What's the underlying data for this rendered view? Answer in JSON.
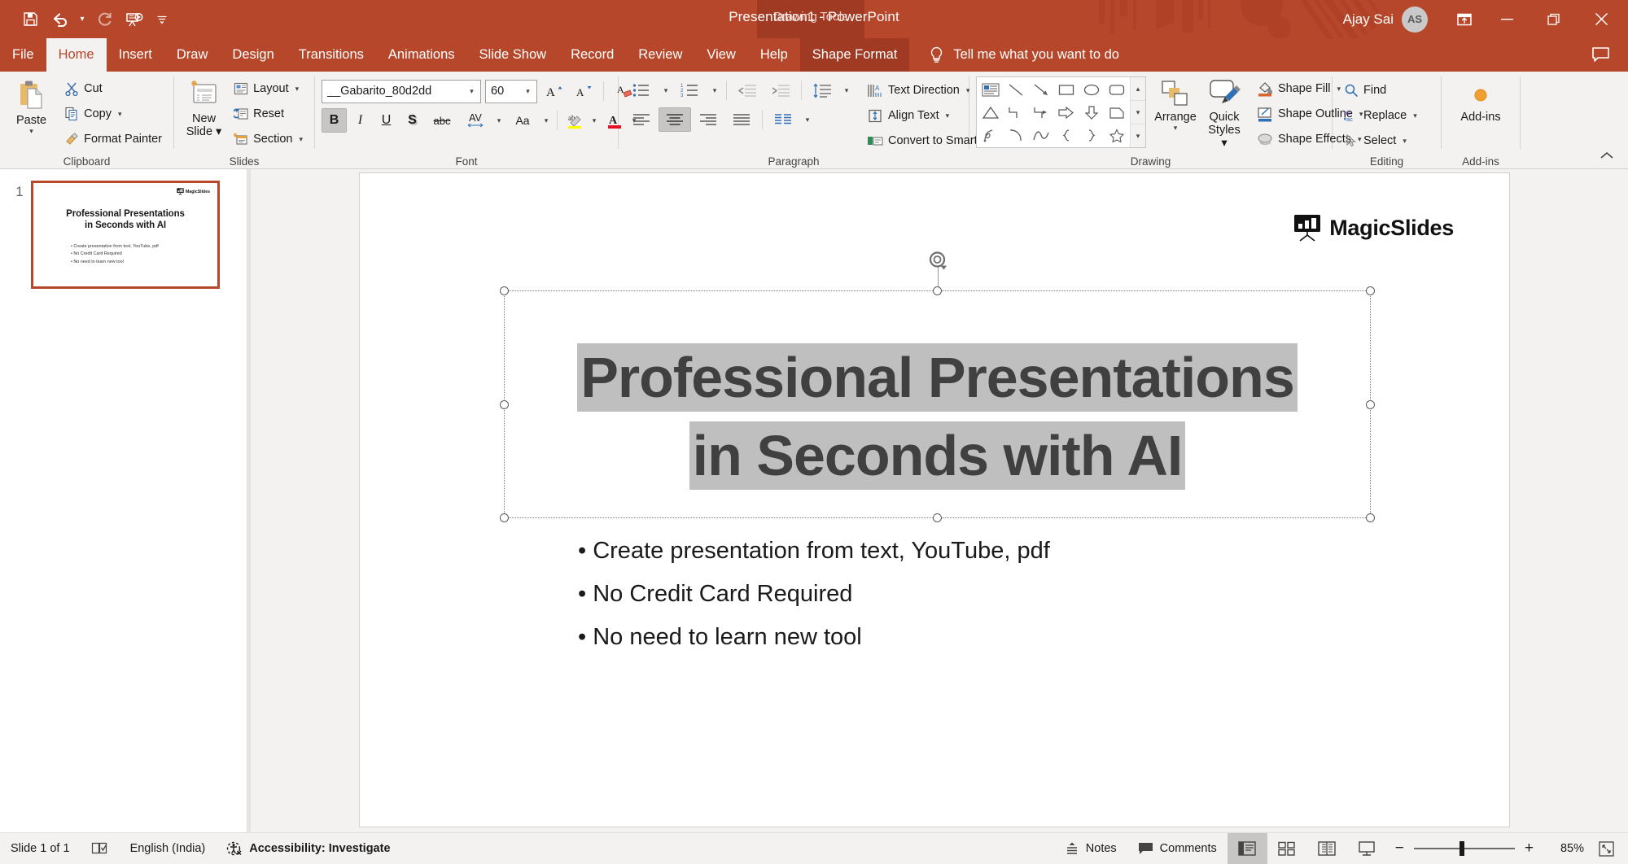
{
  "window": {
    "title": "Presentation1  -  PowerPoint",
    "account_name": "Ajay Sai",
    "account_initials": "AS",
    "contextual_tab_group": "Drawing Tools",
    "accent_color": "#b7472a",
    "contextual_color": "#a03a23"
  },
  "quick_access": [
    {
      "name": "save-icon",
      "label": "Save"
    },
    {
      "name": "undo-icon",
      "label": "Undo"
    },
    {
      "name": "undo-dropdown",
      "label": "Undo options"
    },
    {
      "name": "redo-icon",
      "label": "Redo"
    },
    {
      "name": "start-presentation-icon",
      "label": "Start From Beginning"
    },
    {
      "name": "customize-qat-icon",
      "label": "Customize Quick Access Toolbar"
    }
  ],
  "window_buttons": {
    "ribbon_display": "Ribbon Display Options",
    "minimize": "Minimize",
    "restore": "Restore Down",
    "close": "Close"
  },
  "tabs": [
    {
      "label": "File",
      "active": false
    },
    {
      "label": "Home",
      "active": true
    },
    {
      "label": "Insert",
      "active": false
    },
    {
      "label": "Draw",
      "active": false
    },
    {
      "label": "Design",
      "active": false
    },
    {
      "label": "Transitions",
      "active": false
    },
    {
      "label": "Animations",
      "active": false
    },
    {
      "label": "Slide Show",
      "active": false
    },
    {
      "label": "Record",
      "active": false
    },
    {
      "label": "Review",
      "active": false
    },
    {
      "label": "View",
      "active": false
    },
    {
      "label": "Help",
      "active": false
    },
    {
      "label": "Shape Format",
      "active": false,
      "contextual": true
    }
  ],
  "tell_me": {
    "label": "Tell me what you want to do",
    "icon": "lightbulb-icon"
  },
  "ribbon": {
    "clipboard": {
      "group_label": "Clipboard",
      "paste": "Paste",
      "cut": "Cut",
      "copy": "Copy",
      "format_painter": "Format Painter"
    },
    "slides": {
      "group_label": "Slides",
      "new_slide_line1": "New",
      "new_slide_line2": "Slide",
      "layout": "Layout",
      "reset": "Reset",
      "section": "Section"
    },
    "font": {
      "group_label": "Font",
      "font_name": "__Gabarito_80d2dd",
      "font_size": "60",
      "grow_font": "Increase Font Size",
      "shrink_font": "Decrease Font Size",
      "clear_formatting": "Clear All Formatting",
      "bold": "B",
      "italic": "I",
      "underline": "U",
      "shadow": "S",
      "strikethrough": "abc",
      "char_spacing": "AV",
      "change_case": "Aa",
      "text_highlight": "Text Highlight Color",
      "font_color": "Font Color",
      "bold_active": true
    },
    "paragraph": {
      "group_label": "Paragraph",
      "bullets": "Bullets",
      "numbering": "Numbering",
      "decrease_indent": "Decrease Indent",
      "increase_indent": "Increase Indent",
      "line_spacing": "Line Spacing",
      "align_left": "Align Left",
      "align_center": "Center",
      "align_right": "Align Right",
      "justify": "Justify",
      "columns": "Columns",
      "text_direction": "Text Direction",
      "align_text": "Align Text",
      "convert_smartart": "Convert to SmartArt",
      "center_active": true
    },
    "drawing": {
      "group_label": "Drawing",
      "arrange": "Arrange",
      "quick_styles_line1": "Quick",
      "quick_styles_line2": "Styles",
      "shape_fill": "Shape Fill",
      "shape_outline": "Shape Outline",
      "shape_effects": "Shape Effects",
      "shapes": [
        "textbox",
        "line",
        "arrow",
        "rectangle",
        "oval",
        "rounded-rectangle",
        "triangle",
        "elbow-connector",
        "elbow-arrow-connector",
        "right-arrow",
        "down-arrow",
        "flowchart-shape",
        "scribble",
        "arc",
        "curve",
        "left-brace",
        "right-brace",
        "star"
      ]
    },
    "editing": {
      "group_label": "Editing",
      "find": "Find",
      "replace": "Replace",
      "select": "Select"
    },
    "addins": {
      "group_label": "Add-ins",
      "button": "Add-ins"
    },
    "collapse": "Collapse the Ribbon"
  },
  "thumbnail_pane": {
    "slide_number": "1",
    "title": "Professional Presentations\nin Seconds with AI",
    "title_line1": "Professional Presentations",
    "title_line2": "in Seconds with AI",
    "bullets": [
      "• Create presentation from text, YouTube, pdf",
      "• No Credit Card Required",
      "• No need to learn new tool"
    ],
    "logo_text": "MagicSlides",
    "selected": true
  },
  "slide": {
    "logo_text": "MagicSlides",
    "title_line1": "Professional Presentations",
    "title_line2": "in Seconds with AI",
    "title_selected": true,
    "bullets": [
      "• Create presentation from text, YouTube, pdf",
      "• No Credit Card Required",
      "• No need to learn new tool"
    ],
    "selection_handles": 8,
    "rotation_handle": "rotate-handle"
  },
  "status_bar": {
    "slide_count": "Slide 1 of 1",
    "spellcheck": "Spell check",
    "language": "English (India)",
    "accessibility": "Accessibility: Investigate",
    "notes": "Notes",
    "comments": "Comments",
    "views": [
      {
        "name": "normal-view",
        "label": "Normal",
        "active": true
      },
      {
        "name": "slide-sorter-view",
        "label": "Slide Sorter",
        "active": false
      },
      {
        "name": "reading-view",
        "label": "Reading View",
        "active": false
      },
      {
        "name": "slide-show-view",
        "label": "Slide Show",
        "active": false
      }
    ],
    "zoom_out": "−",
    "zoom_in": "+",
    "zoom_level": "85%",
    "fit_slide": "Fit slide to current window"
  }
}
